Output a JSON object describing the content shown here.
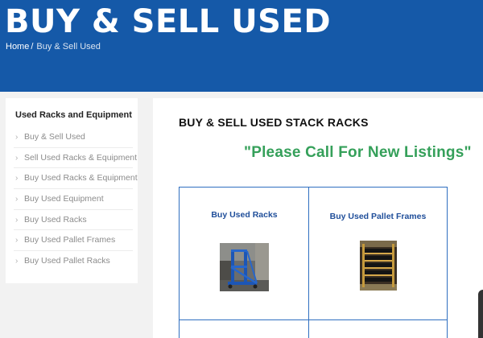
{
  "hero": {
    "title": "BUY & SELL USED",
    "breadcrumb": {
      "home": "Home",
      "separator": "/",
      "current": "Buy & Sell Used"
    }
  },
  "sidebar": {
    "heading": "Used Racks and Equipment",
    "items": [
      {
        "label": "Buy & Sell Used"
      },
      {
        "label": "Sell Used Racks & Equipment"
      },
      {
        "label": "Buy Used Racks & Equipment"
      },
      {
        "label": "Buy Used Equipment"
      },
      {
        "label": "Buy Used Racks"
      },
      {
        "label": "Buy Used Pallet Frames"
      },
      {
        "label": "Buy Used Pallet Racks"
      }
    ]
  },
  "main": {
    "section_title": "BUY & SELL USED STACK RACKS",
    "callout": "\"Please Call For New Listings\"",
    "cards": [
      {
        "label": "Buy Used Racks",
        "image_icon": "blue-rack-photo"
      },
      {
        "label": "Buy Used Pallet Frames",
        "image_icon": "pallet-frames-photo"
      }
    ]
  },
  "colors": {
    "brand_blue": "#1559a8",
    "grid_border": "#2f6fc0",
    "link_blue": "#1f4e9a",
    "callout_green": "#35a05a"
  }
}
